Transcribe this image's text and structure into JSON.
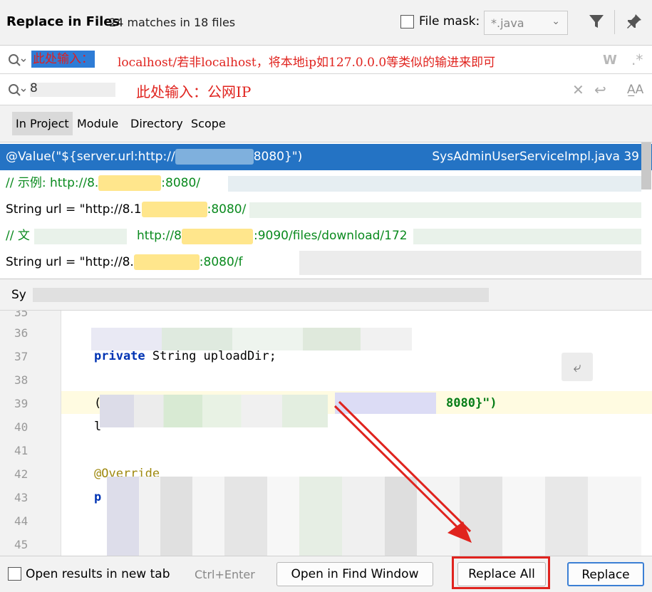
{
  "header": {
    "title": "Replace in Files",
    "matches": "24 matches in 18 files",
    "file_mask_label": "File mask:",
    "file_mask_value": "*.java",
    "icons": [
      "filter-icon",
      "pin-icon"
    ]
  },
  "search": {
    "selected_text": "此处输入：",
    "annotation": "localhost/若非localhost，将本地ip如127.0.0.0等类似的输进来即可",
    "icons": [
      "search-icon",
      "w-icon",
      "regex-icon"
    ]
  },
  "replace": {
    "first_char": "8",
    "annotation": "此处输入：公网IP",
    "icons": [
      "search-icon",
      "clear-icon",
      "enter-icon",
      "match-case-icon"
    ]
  },
  "scope_tabs": [
    {
      "label": "In Project",
      "active": true
    },
    {
      "label": "Module",
      "active": false
    },
    {
      "label": "Directory",
      "active": false
    },
    {
      "label": "Scope",
      "active": false
    }
  ],
  "results": [
    {
      "prefix": "@Value(\"${server.url:http://",
      "suffix": "8080}\")",
      "file": "SysAdminUserServiceImpl.java 39"
    },
    {
      "prefix": "// 示例: http://8.",
      "suffix": ":8080/"
    },
    {
      "prefix": "String url = \"http://8.1",
      "suffix": ":8080/"
    },
    {
      "prefix": "// 文",
      "suffix": "http://8",
      "tail": ":9090/files/download/172"
    },
    {
      "prefix": "String url = \"http://8.",
      "suffix": ":8080/f"
    }
  ],
  "preview": {
    "label": "Sy",
    "lines": [
      {
        "num": "35",
        "text": ""
      },
      {
        "num": "36",
        "text": ""
      },
      {
        "num": "37",
        "kw": "private",
        "text": " String uploadDir;"
      },
      {
        "num": "38",
        "text": ""
      },
      {
        "num": "39",
        "text": "(",
        "str": "8080}\")"
      },
      {
        "num": "40",
        "text": "l"
      },
      {
        "num": "41",
        "text": ""
      },
      {
        "num": "42",
        "text": "@Override"
      },
      {
        "num": "43",
        "text": "p"
      },
      {
        "num": "44",
        "text": ""
      },
      {
        "num": "45",
        "text": ""
      }
    ]
  },
  "footer": {
    "open_new_tab": "Open results in new tab",
    "shortcut": "Ctrl+Enter",
    "open_find_window": "Open in Find Window",
    "replace_all": "Replace All",
    "replace": "Replace"
  },
  "colors": {
    "accent": "#2473c4",
    "annotation_red": "#e0231e",
    "string_green": "#0a8a1e",
    "highlight": "#ffe68c"
  }
}
